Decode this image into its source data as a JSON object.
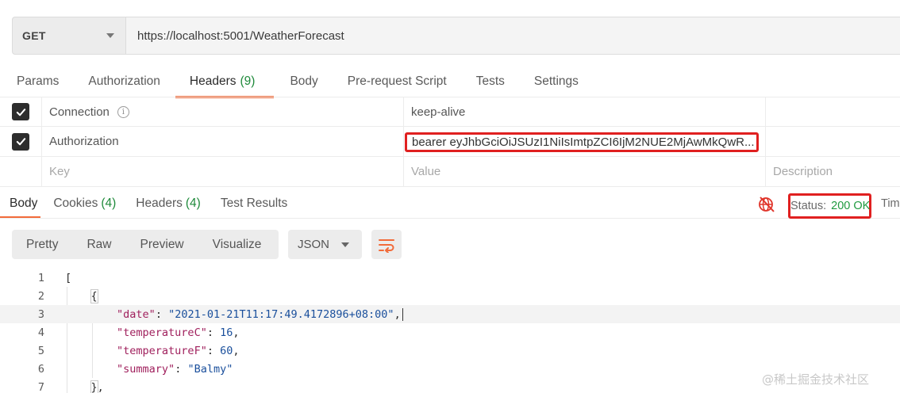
{
  "request": {
    "method": "GET",
    "url": "https://localhost:5001/WeatherForecast"
  },
  "request_tabs": [
    {
      "label": "Params",
      "count": ""
    },
    {
      "label": "Authorization",
      "count": ""
    },
    {
      "label": "Headers",
      "count": "(9)"
    },
    {
      "label": "Body",
      "count": ""
    },
    {
      "label": "Pre-request Script",
      "count": ""
    },
    {
      "label": "Tests",
      "count": ""
    },
    {
      "label": "Settings",
      "count": ""
    }
  ],
  "headers_table": {
    "rows": [
      {
        "key": "Connection",
        "value": "keep-alive",
        "checked": true
      },
      {
        "key": "Authorization",
        "value": "bearer eyJhbGciOiJSUzI1NiIsImtpZCI6IjM2NUE2MjAwMkQwR...",
        "checked": true
      }
    ],
    "placeholders": {
      "key": "Key",
      "value": "Value",
      "description": "Description"
    }
  },
  "response_tabs": [
    {
      "label": "Body",
      "count": ""
    },
    {
      "label": "Cookies",
      "count": "(4)"
    },
    {
      "label": "Headers",
      "count": "(4)"
    },
    {
      "label": "Test Results",
      "count": ""
    }
  ],
  "response_status": {
    "label": "Status:",
    "value": "200 OK",
    "time_label": "Tim"
  },
  "view_toolbar": {
    "buttons": [
      "Pretty",
      "Raw",
      "Preview",
      "Visualize"
    ],
    "format": "JSON"
  },
  "code_lines": [
    {
      "n": "1",
      "parts": [
        {
          "t": "[",
          "c": "p"
        }
      ]
    },
    {
      "n": "2",
      "parts": [
        {
          "t": "    ",
          "c": "p"
        },
        {
          "t": "{",
          "c": "b"
        }
      ]
    },
    {
      "n": "3",
      "parts": [
        {
          "t": "        ",
          "c": "p"
        },
        {
          "t": "\"date\"",
          "c": "k"
        },
        {
          "t": ": ",
          "c": "p"
        },
        {
          "t": "\"2021-01-21T11:17:49.4172896+08:00\"",
          "c": "s"
        },
        {
          "t": ",",
          "c": "p"
        }
      ]
    },
    {
      "n": "4",
      "parts": [
        {
          "t": "        ",
          "c": "p"
        },
        {
          "t": "\"temperatureC\"",
          "c": "k"
        },
        {
          "t": ": ",
          "c": "p"
        },
        {
          "t": "16",
          "c": "s"
        },
        {
          "t": ",",
          "c": "p"
        }
      ]
    },
    {
      "n": "5",
      "parts": [
        {
          "t": "        ",
          "c": "p"
        },
        {
          "t": "\"temperatureF\"",
          "c": "k"
        },
        {
          "t": ": ",
          "c": "p"
        },
        {
          "t": "60",
          "c": "s"
        },
        {
          "t": ",",
          "c": "p"
        }
      ]
    },
    {
      "n": "6",
      "parts": [
        {
          "t": "        ",
          "c": "p"
        },
        {
          "t": "\"summary\"",
          "c": "k"
        },
        {
          "t": ": ",
          "c": "p"
        },
        {
          "t": "\"Balmy\"",
          "c": "s"
        }
      ]
    },
    {
      "n": "7",
      "parts": [
        {
          "t": "    ",
          "c": "p"
        },
        {
          "t": "}",
          "c": "b"
        },
        {
          "t": ",",
          "c": "p"
        }
      ]
    }
  ],
  "watermark": "@稀土掘金技术社区",
  "colors": {
    "accent": "#f26b3a",
    "highlight_border": "#e02020",
    "status_ok": "#1f9a3f",
    "count": "#1f8a3b"
  }
}
